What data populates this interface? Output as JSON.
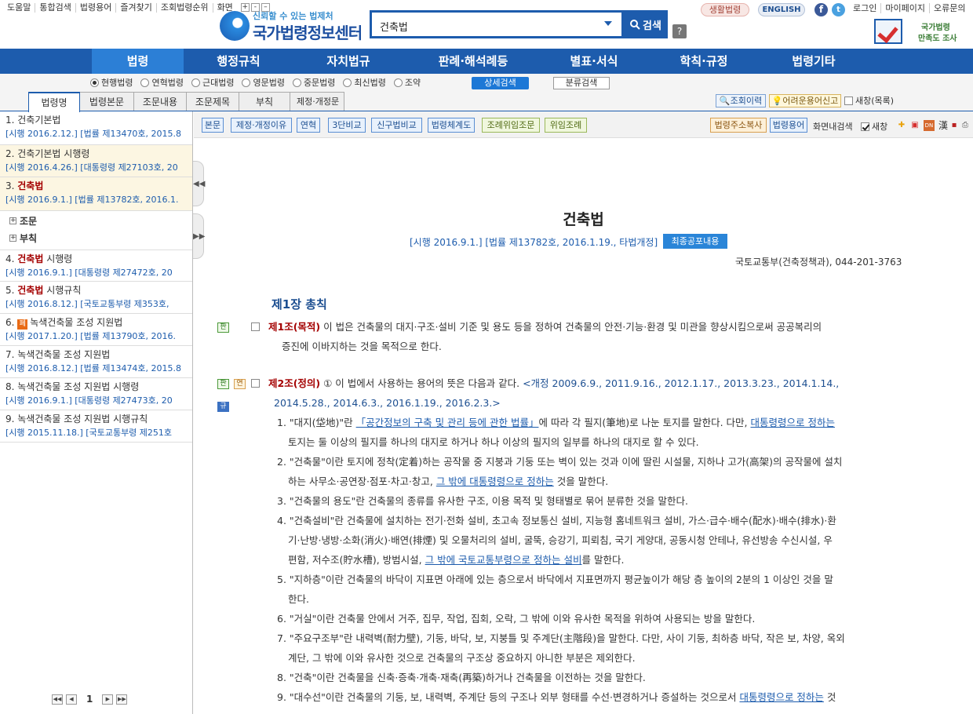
{
  "util_links": [
    "도움말",
    "통합검색",
    "법령용어",
    "즐겨찾기",
    "조회법령순위",
    "화면"
  ],
  "logo": {
    "slogan": "신뢰할 수 있는 법제처",
    "name": "국가법령정보센터"
  },
  "search": {
    "value": "건축법",
    "button": "검색"
  },
  "help": "?",
  "life_law": "생활법령",
  "english": "ENGLISH",
  "social": {
    "facebook": "f",
    "twitter": "t"
  },
  "top_links": [
    "로그인",
    "마이페이지",
    "오류문의"
  ],
  "survey": {
    "line1": "국가법령",
    "line2": "만족도 조사"
  },
  "main_nav": [
    "법령",
    "행정규칙",
    "자치법규",
    "판례·해석례등",
    "별표·서식",
    "학칙·규정",
    "법령기타"
  ],
  "options": [
    "현행법령",
    "연혁법령",
    "근대법령",
    "영문법령",
    "중문법령",
    "최신법령",
    "조약"
  ],
  "detail_search": "상세검색",
  "class_search": "분류검색",
  "tabs": [
    "법령명",
    "법령본문",
    "조문내용",
    "조문제목",
    "부칙",
    "제정·개정문"
  ],
  "history": "조회이력",
  "report": "어려운용어신고",
  "new_window": "새창(목록)",
  "results": [
    {
      "title": "1. 건축기본법",
      "sub": "[시행 2016.2.12.] [법률 제13470호, 2015.8"
    },
    {
      "title": "2. 건축기본법 시행령",
      "sub": "[시행 2016.4.26.] [대통령령 제27103호, 20"
    },
    {
      "title_pre": "3. ",
      "title_bold": "건축법",
      "title_post": "",
      "sub": "[시행 2016.9.1.] [법률 제13782호, 2016.1."
    },
    {
      "title_pre": "4. ",
      "title_bold": "건축법",
      "title_post": " 시행령",
      "sub": "[시행 2016.9.1.] [대통령령 제27472호, 20"
    },
    {
      "title_pre": "5. ",
      "title_bold": "건축법",
      "title_post": " 시행규칙",
      "sub": "[시행 2016.8.12.] [국토교통부령 제353호,"
    },
    {
      "title_pre": "6. ",
      "tag": "폐",
      "title_post": "녹색건축물 조성 지원법",
      "sub": "[시행 2017.1.20.] [법률 제13790호, 2016."
    },
    {
      "title": "7. 녹색건축물 조성 지원법",
      "sub": "[시행 2016.8.12.] [법률 제13474호, 2015.8"
    },
    {
      "title": "8. 녹색건축물 조성 지원법 시행령",
      "sub": "[시행 2016.9.1.] [대통령령 제27473호, 20"
    },
    {
      "title": "9. 녹색건축물 조성 지원법 시행규칙",
      "sub": "[시행 2015.11.18.] [국토교통부령 제251호"
    }
  ],
  "tree": [
    "조문",
    "부칙"
  ],
  "pager": {
    "first": "◀◀",
    "prev": "◀",
    "page": "1",
    "next": "▶",
    "last": "▶▶"
  },
  "toolbar": {
    "buttons": [
      "본문",
      "제정·개정이유",
      "연혁",
      "3단비교",
      "신구법비교",
      "법령체계도",
      "조례위임조문",
      "위임조례"
    ],
    "copy_address": "법령주소복사",
    "law_terms": "법령용어",
    "screen_search": "화면내검색",
    "new_win": "새창",
    "hanja": "漢"
  },
  "law": {
    "title": "건축법",
    "info": "[시행 2016.9.1.] [법률 제13782호, 2016.1.19., 타법개정]",
    "latest": "최종공포내용",
    "ministry": "국토교통부(건축정책과), 044-201-3763",
    "chapter": "제1장 총칙",
    "badges": {
      "pan": "판",
      "yeon": "연",
      "gyu": "규"
    },
    "art1": {
      "title": "제1조(목적)",
      "line1": " 이 법은 건축물의 대지·구조·설비 기준 및 용도 등을 정하여 건축물의 안전·기능·환경 및 미관을 향상시킴으로써 공공복리의",
      "line2": "증진에 이바지하는 것을 목적으로 한다."
    },
    "art2": {
      "title": "제2조(정의)",
      "line1": " ① 이 법에서 사용하는 용어의 뜻은 다음과 같다. ",
      "amend1": "<개정 2009.6.9., 2011.9.16., 2012.1.17., 2013.3.23., 2014.1.14.,",
      "amend2": "2014.5.28., 2014.6.3., 2016.1.19., 2016.2.3.>"
    },
    "items": [
      {
        "a": "1. \"대지(垈地)\"란 ",
        "l1": "「공간정보의 구축 및 관리 등에 관한 법률」",
        "b": "에 따라 각 필지(筆地)로 나눈 토지를 말한다. 다만, ",
        "l2": "대통령령으로 정하는",
        "c": "토지는 둘 이상의 필지를 하나의 대지로 하거나 하나 이상의 필지의 일부를 하나의 대지로 할 수 있다."
      },
      {
        "a": "2. \"건축물\"이란 토지에 정착(定着)하는 공작물 중 지붕과 기둥 또는 벽이 있는 것과 이에 딸린 시설물, 지하나 고가(高架)의 공작물에 설치",
        "b": "하는 사무소·공연장·점포·차고·창고, ",
        "l1": "그 밖에 대통령령으로 정하는",
        "c": " 것을 말한다."
      },
      {
        "a": "3. \"건축물의 용도\"란 건축물의 종류를 유사한 구조, 이용 목적 및 형태별로 묶어 분류한 것을 말한다."
      },
      {
        "a": "4. \"건축설비\"란 건축물에 설치하는 전기·전화 설비, 초고속 정보통신 설비, 지능형 홈네트워크 설비, 가스·급수·배수(配水)·배수(排水)·환",
        "b": "기·난방·냉방·소화(消火)·배연(排煙) 및 오물처리의 설비, 굴뚝, 승강기, 피뢰침, 국기 게양대, 공동시청 안테나, 유선방송 수신시설, 우",
        "c": "편함, 저수조(貯水槽), 방범시설, ",
        "l1": "그 밖에 국토교통부령으로 정하는 설비",
        "d": "를 말한다."
      },
      {
        "a": "5. \"지하층\"이란 건축물의 바닥이 지표면 아래에 있는 층으로서 바닥에서 지표면까지 평균높이가 해당 층 높이의 2분의 1 이상인 것을 말",
        "b": "한다."
      },
      {
        "a": "6. \"거실\"이란 건축물 안에서 거주, 집무, 작업, 집회, 오락, 그 밖에 이와 유사한 목적을 위하여 사용되는 방을 말한다."
      },
      {
        "a": "7. \"주요구조부\"란 내력벽(耐力壁), 기둥, 바닥, 보, 지붕틀 및 주계단(主階段)을 말한다. 다만, 사이 기둥, 최하층 바닥, 작은 보, 차양, 옥외",
        "b": "계단, 그 밖에 이와 유사한 것으로 건축물의 구조상 중요하지 아니한 부분은 제외한다."
      },
      {
        "a": "8. \"건축\"이란 건축물을 신축·증축·개축·재축(再築)하거나 건축물을 이전하는 것을 말한다."
      },
      {
        "a": "9. \"대수선\"이란 건축물의 기둥, 보, 내력벽, 주계단 등의 구조나 외부 형태를 수선·변경하거나 증설하는 것으로서 ",
        "l1": "대통령령으로 정하는",
        "b": " 것"
      }
    ]
  }
}
